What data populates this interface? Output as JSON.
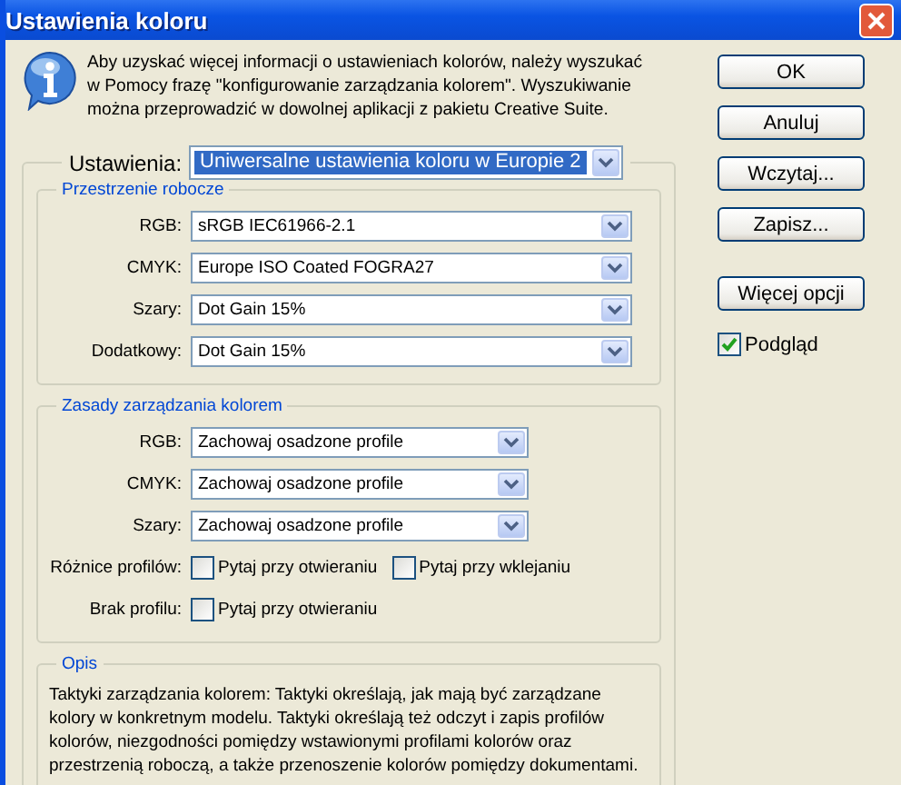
{
  "window": {
    "title": "Ustawienia koloru"
  },
  "info": {
    "text": "Aby uzyskać więcej informacji o ustawieniach kolorów, należy wyszukać w Pomocy frazę \"konfigurowanie zarządzania kolorem\". Wyszukiwanie można przeprowadzić w dowolnej aplikacji z pakietu Creative Suite."
  },
  "settings": {
    "label": "Ustawienia:",
    "value": "Uniwersalne ustawienia koloru w Europie 2"
  },
  "working_spaces": {
    "title": "Przestrzenie robocze",
    "rows": [
      {
        "label": "RGB:",
        "value": "sRGB IEC61966-2.1"
      },
      {
        "label": "CMYK:",
        "value": "Europe ISO Coated FOGRA27"
      },
      {
        "label": "Szary:",
        "value": "Dot Gain 15%"
      },
      {
        "label": "Dodatkowy:",
        "value": "Dot Gain 15%"
      }
    ]
  },
  "policies": {
    "title": "Zasady zarządzania kolorem",
    "rows": [
      {
        "label": "RGB:",
        "value": "Zachowaj osadzone profile"
      },
      {
        "label": "CMYK:",
        "value": "Zachowaj osadzone profile"
      },
      {
        "label": "Szary:",
        "value": "Zachowaj osadzone profile"
      }
    ],
    "mismatch": {
      "label": "Różnice profilów:",
      "options": [
        {
          "label": "Pytaj przy otwieraniu",
          "checked": false
        },
        {
          "label": "Pytaj przy wklejaniu",
          "checked": false
        }
      ]
    },
    "missing": {
      "label": "Brak profilu:",
      "options": [
        {
          "label": "Pytaj przy otwieraniu",
          "checked": false
        }
      ]
    }
  },
  "description": {
    "title": "Opis",
    "text": "Taktyki zarządzania kolorem: Taktyki określają, jak mają być zarządzane kolory w konkretnym modelu. Taktyki określają też odczyt i zapis profilów kolorów, niezgodności pomiędzy wstawionymi profilami kolorów oraz przestrzenią roboczą, a także przenoszenie kolorów pomiędzy dokumentami."
  },
  "buttons": [
    "OK",
    "Anuluj",
    "Wczytaj...",
    "Zapisz...",
    "Więcej opcji"
  ],
  "preview": {
    "label": "Podgląd",
    "checked": true
  }
}
